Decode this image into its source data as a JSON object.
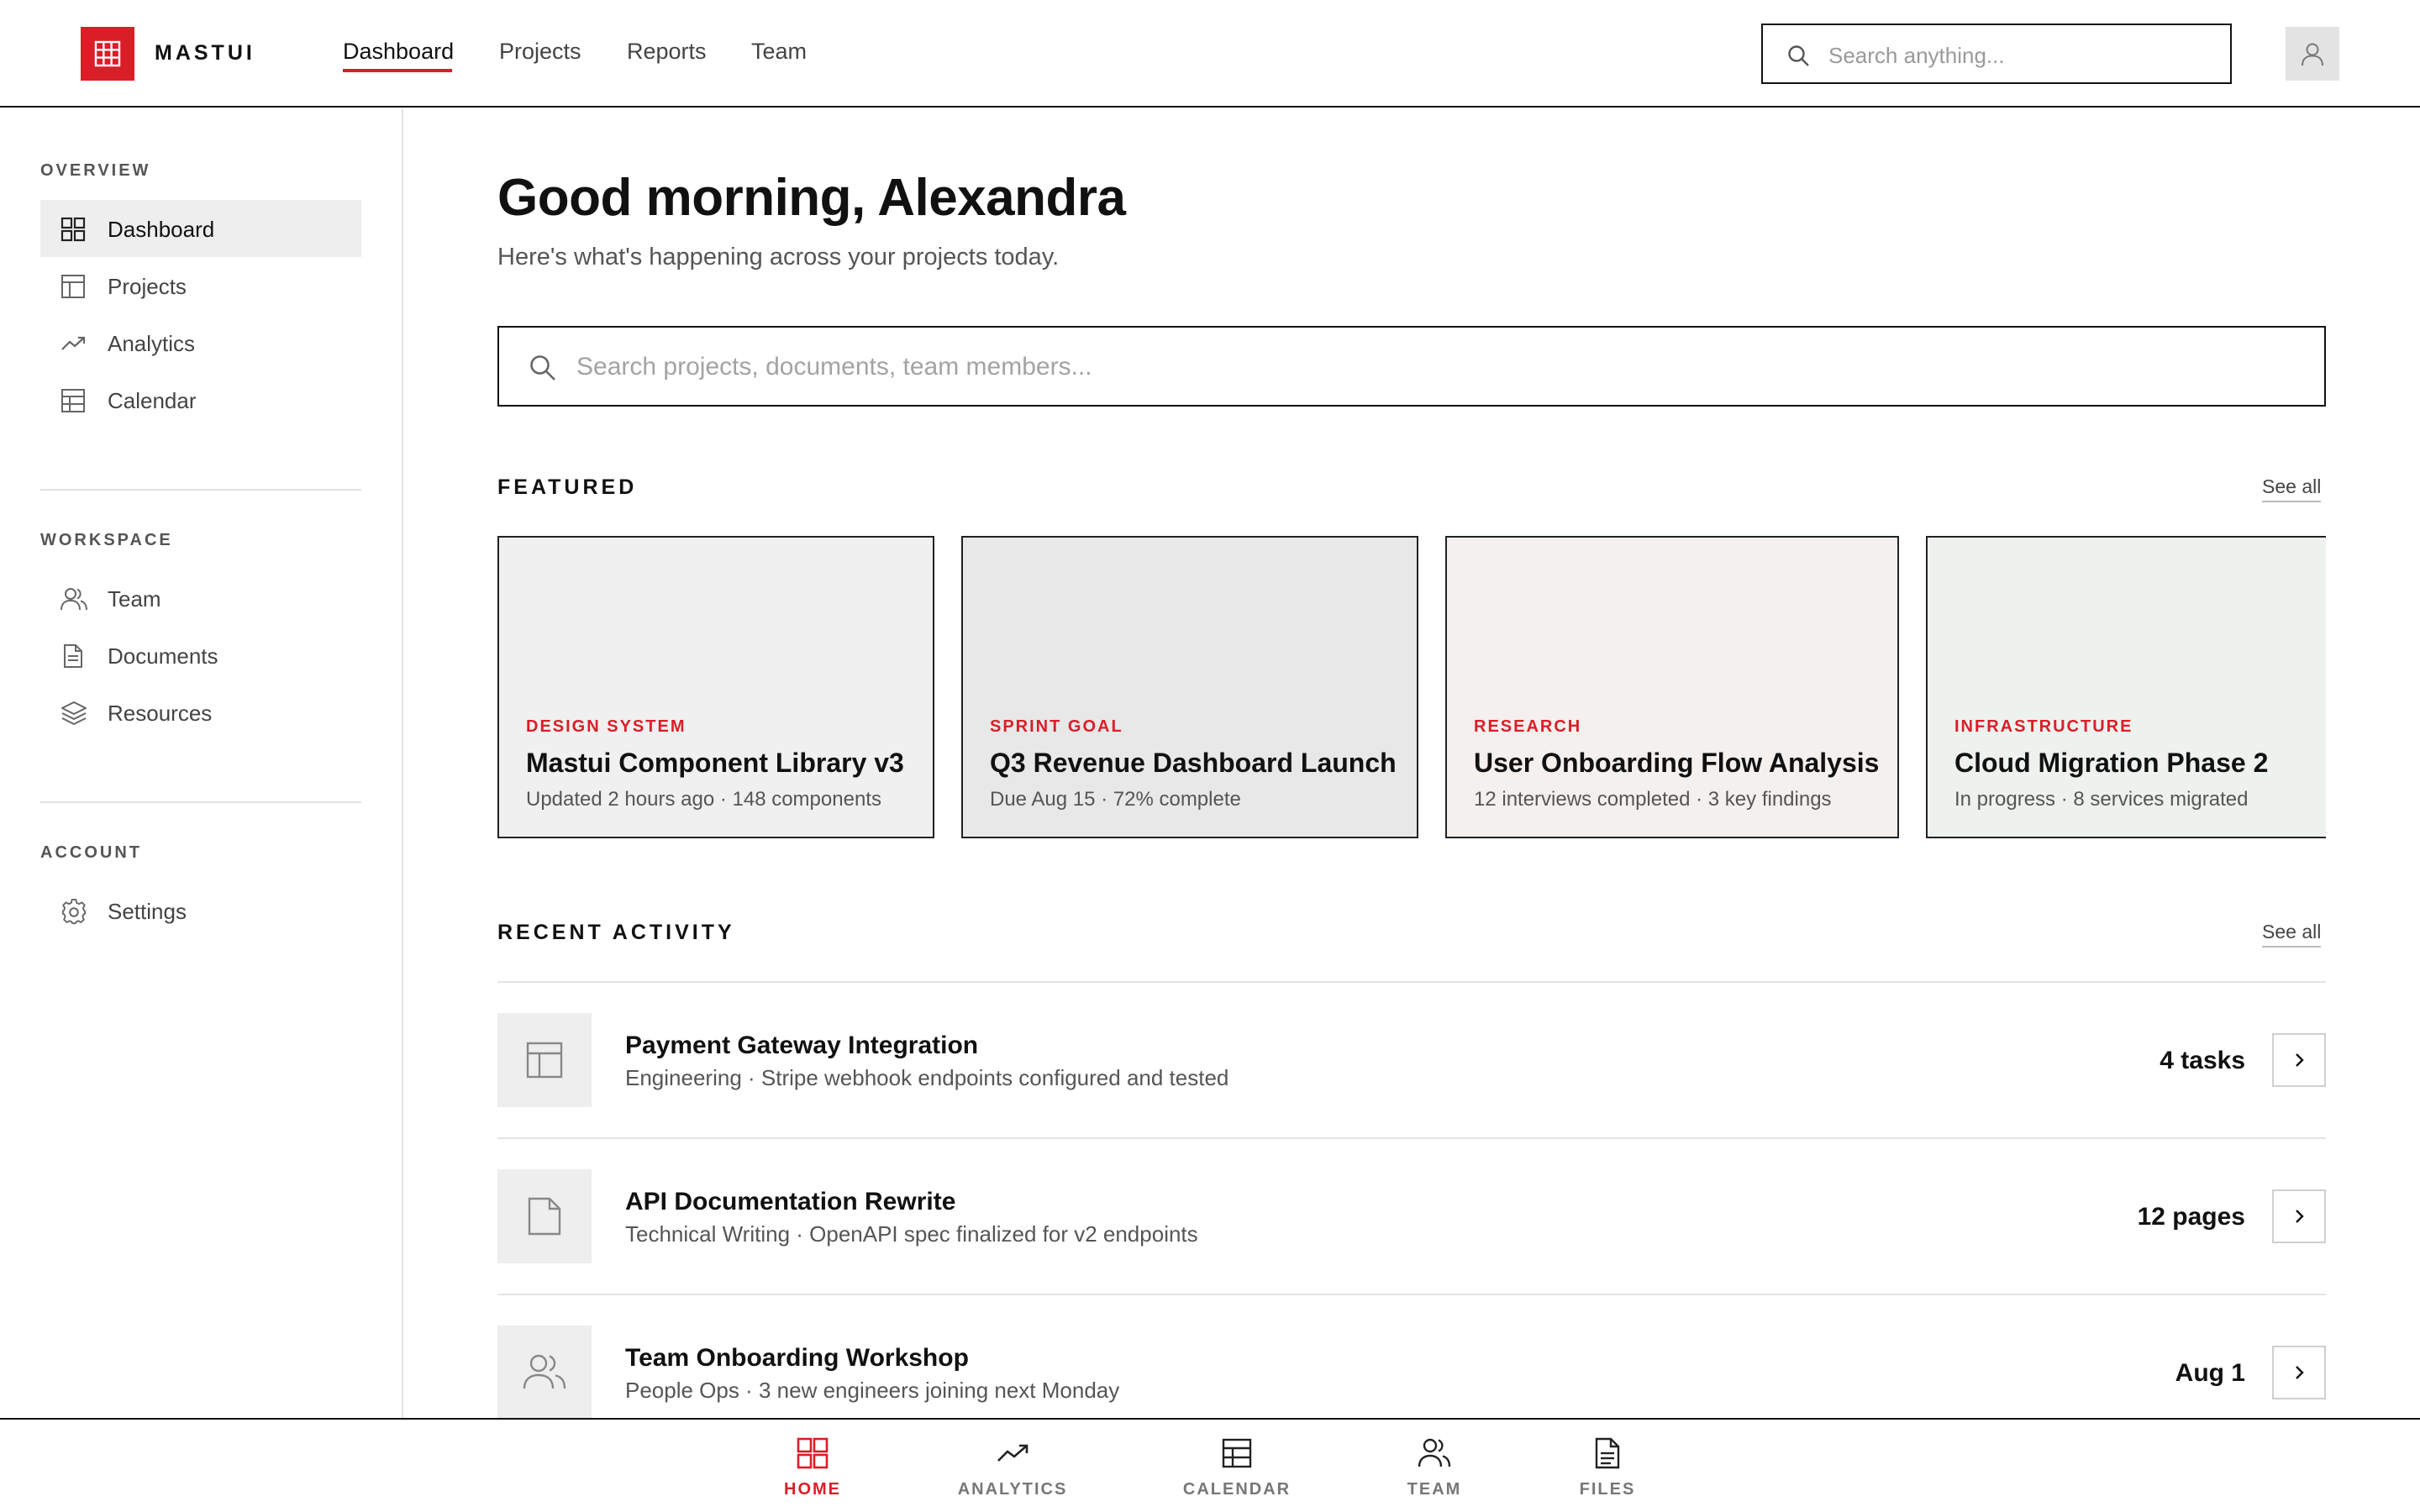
{
  "brand": {
    "name": "MASTUI",
    "accent": "#da1e28"
  },
  "topnav": {
    "items": [
      {
        "label": "Dashboard",
        "active": true
      },
      {
        "label": "Projects",
        "active": false
      },
      {
        "label": "Reports",
        "active": false
      },
      {
        "label": "Team",
        "active": false
      }
    ],
    "search_placeholder": "Search anything...",
    "avatar_icon": "user-icon"
  },
  "sidebar": {
    "sections": [
      {
        "heading": "OVERVIEW",
        "items": [
          {
            "label": "Dashboard",
            "icon": "grid-icon",
            "active": true
          },
          {
            "label": "Projects",
            "icon": "table-icon",
            "active": false
          },
          {
            "label": "Analytics",
            "icon": "trend-icon",
            "active": false
          },
          {
            "label": "Calendar",
            "icon": "calendar-icon",
            "active": false
          }
        ]
      },
      {
        "heading": "WORKSPACE",
        "items": [
          {
            "label": "Team",
            "icon": "users-icon",
            "active": false
          },
          {
            "label": "Documents",
            "icon": "document-icon",
            "active": false
          },
          {
            "label": "Resources",
            "icon": "layers-icon",
            "active": false
          }
        ]
      },
      {
        "heading": "ACCOUNT",
        "items": [
          {
            "label": "Settings",
            "icon": "gear-icon",
            "active": false
          }
        ]
      }
    ]
  },
  "main": {
    "greeting": "Good morning, Alexandra",
    "subtitle": "Here's what's happening across your projects today.",
    "search_placeholder": "Search projects, documents, team members...",
    "featured": {
      "title": "FEATURED",
      "see_all": "See all",
      "cards": [
        {
          "tag": "DESIGN SYSTEM",
          "title": "Mastui Component Library v3",
          "meta": "Updated 2 hours ago · 148 components",
          "bg": "#f0f0f0"
        },
        {
          "tag": "SPRINT GOAL",
          "title": "Q3 Revenue Dashboard Launch",
          "meta": "Due Aug 15 · 72% complete",
          "bg": "#e8e8e8"
        },
        {
          "tag": "RESEARCH",
          "title": "User Onboarding Flow Analysis",
          "meta": "12 interviews completed · 3 key findings",
          "bg": "#f3f0ee"
        },
        {
          "tag": "INFRASTRUCTURE",
          "title": "Cloud Migration Phase 2",
          "meta": "In progress · 8 services migrated",
          "bg": "#eef2ee"
        }
      ]
    },
    "activity": {
      "title": "RECENT ACTIVITY",
      "see_all": "See all",
      "items": [
        {
          "title": "Payment Gateway Integration",
          "meta": "Engineering · Stripe webhook endpoints configured and tested",
          "count": "4 tasks",
          "icon": "table-icon"
        },
        {
          "title": "API Documentation Rewrite",
          "meta": "Technical Writing · OpenAPI spec finalized for v2 endpoints",
          "count": "12 pages",
          "icon": "document-icon"
        },
        {
          "title": "Team Onboarding Workshop",
          "meta": "People Ops · 3 new engineers joining next Monday",
          "count": "Aug 1",
          "icon": "users-icon"
        }
      ]
    }
  },
  "bottombar": {
    "items": [
      {
        "label": "HOME",
        "icon": "grid-icon",
        "active": true
      },
      {
        "label": "ANALYTICS",
        "icon": "trend-icon",
        "active": false
      },
      {
        "label": "CALENDAR",
        "icon": "calendar-icon",
        "active": false
      },
      {
        "label": "TEAM",
        "icon": "users-icon",
        "active": false
      },
      {
        "label": "FILES",
        "icon": "document-icon",
        "active": false
      }
    ]
  }
}
